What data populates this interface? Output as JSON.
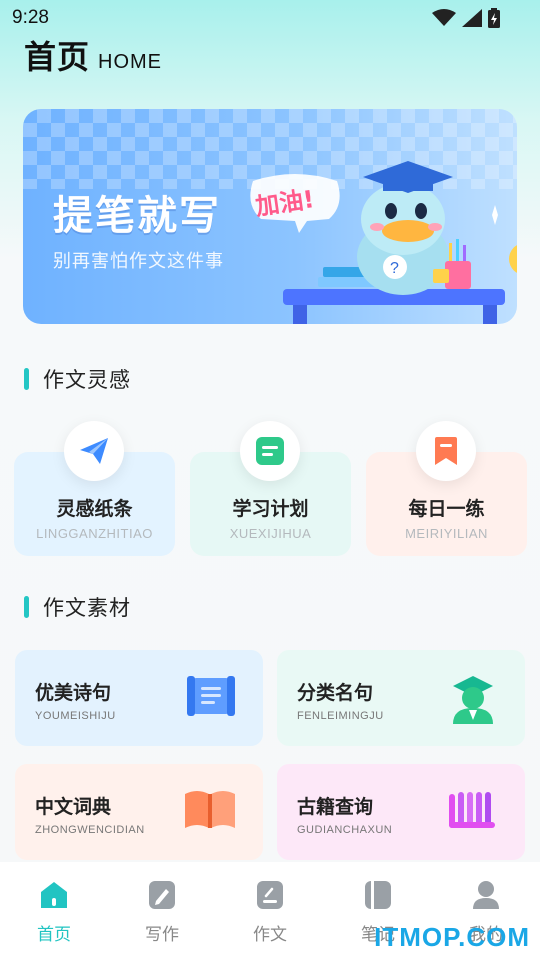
{
  "status": {
    "time": "9:28"
  },
  "header": {
    "title": "首页",
    "subtitle": "HOME"
  },
  "banner": {
    "title": "提笔就写",
    "subtitle": "别再害怕作文这件事",
    "sticker": "加油!"
  },
  "inspiration": {
    "title": "作文灵感",
    "items": [
      {
        "label": "灵感纸条",
        "pinyin": "LINGGANZHITIAO",
        "icon": "paper-plane-icon",
        "color": "#3d8bff"
      },
      {
        "label": "学习计划",
        "pinyin": "XUEXIJIHUA",
        "icon": "notebook-icon",
        "color": "#2ec98a"
      },
      {
        "label": "每日一练",
        "pinyin": "MEIRIYILIAN",
        "icon": "bookmark-icon",
        "color": "#ff7a52"
      }
    ]
  },
  "materials": {
    "title": "作文素材",
    "items": [
      {
        "title": "优美诗句",
        "pinyin": "YOUMEISHIJU",
        "icon": "scroll-icon"
      },
      {
        "title": "分类名句",
        "pinyin": "FENLEIMINGJU",
        "icon": "graduate-icon"
      },
      {
        "title": "中文词典",
        "pinyin": "ZHONGWENCIDIAN",
        "icon": "open-book-icon"
      },
      {
        "title": "古籍查询",
        "pinyin": "GUDIANCHAXUN",
        "icon": "bamboo-slips-icon"
      }
    ]
  },
  "tabs": [
    {
      "label": "首页",
      "active": true
    },
    {
      "label": "写作",
      "active": false
    },
    {
      "label": "作文",
      "active": false
    },
    {
      "label": "笔记",
      "active": false
    },
    {
      "label": "我的",
      "active": false
    }
  ],
  "watermark": "ITMOP.COM",
  "colors": {
    "accent": "#21c4c2"
  }
}
